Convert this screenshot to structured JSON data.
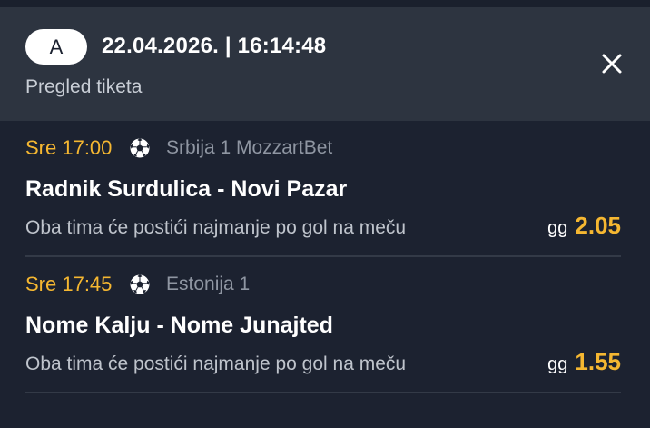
{
  "header": {
    "ticket_badge": "A",
    "datetime": "22.04.2026. | 16:14:48",
    "subtitle": "Pregled tiketa",
    "close_icon": "close-icon"
  },
  "colors": {
    "background": "#1c2230",
    "header_background": "#2d3440",
    "accent": "#f5b731",
    "text_primary": "#ffffff",
    "text_secondary": "#8f96a2"
  },
  "matches": [
    {
      "time": "Sre 17:00",
      "sport_icon": "soccer-ball-icon",
      "league": "Srbija 1 MozzartBet",
      "teams": "Radnik Surdulica - Novi Pazar",
      "market": "Oba tima će postići najmanje po gol na meču",
      "pick": "gg",
      "odd": "2.05"
    },
    {
      "time": "Sre 17:45",
      "sport_icon": "soccer-ball-icon",
      "league": "Estonija 1",
      "teams": "Nome Kalju - Nome Junajted",
      "market": "Oba tima će postići najmanje po gol na meču",
      "pick": "gg",
      "odd": "1.55"
    }
  ]
}
